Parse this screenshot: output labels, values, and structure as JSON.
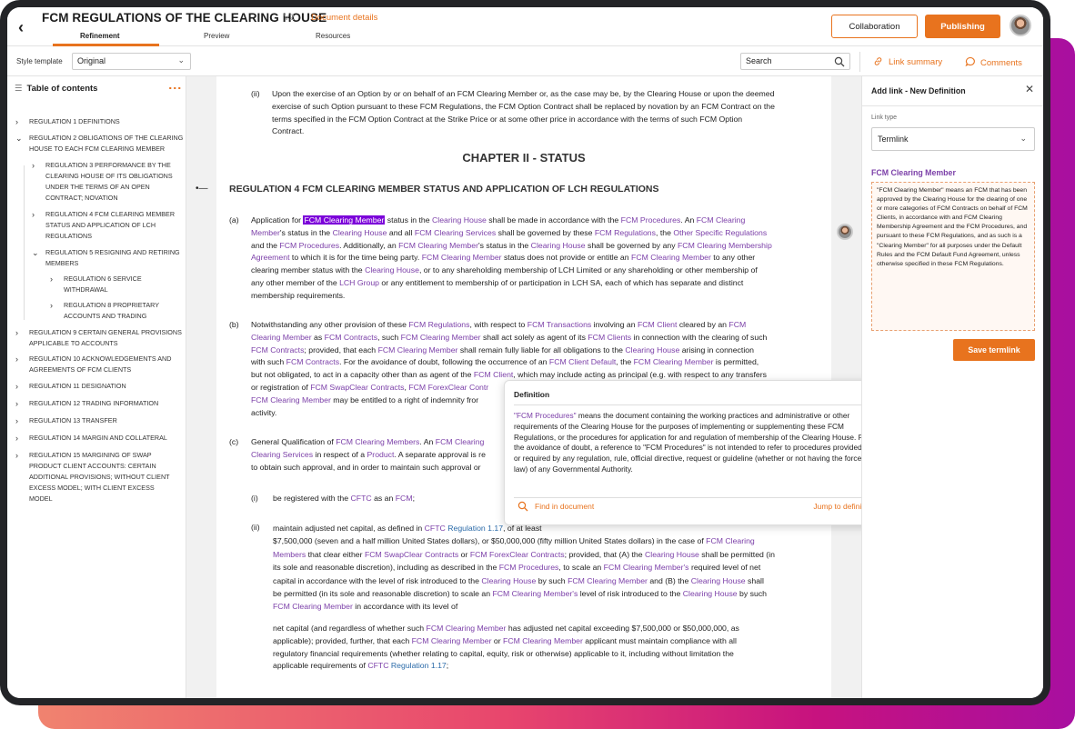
{
  "header": {
    "back": "‹",
    "title": "FCM REGULATIONS OF THE CLEARING HOUSE",
    "version": "V2",
    "details": "Document details",
    "tabs": [
      "Refinement",
      "Preview",
      "Resources"
    ],
    "collaboration": "Collaboration",
    "publishing": "Publishing"
  },
  "toolbar": {
    "style_label": "Style template",
    "style_value": "Original",
    "search_value": "Search",
    "link_summary": "Link summary",
    "comments": "Comments"
  },
  "toc": {
    "title": "Table of contents",
    "items": [
      "Regulation 1 DEFINITIONS",
      [
        "Regulation 2 OBLIGATIONS OF THE CLEARING",
        "HOUSE TO EACH FCM CLEARING MEMBER"
      ],
      [
        "Regulation 3 PERFORMANCE BY THE",
        "CLEARING HOUSE OF ITS OBLIGATIONS",
        "UNDER THE TERMS OF AN OPEN",
        "CONTRACT; NOVATION"
      ],
      [
        "Regulation 4 FCM CLEARING MEMBER",
        "STATUS AND APPLICATION OF LCH",
        "REGULATIONS"
      ],
      [
        "Regulation 5 RESIGNING AND RETIRING",
        "MEMBERS"
      ],
      [
        "Regulation 6 SERVICE",
        "WITHDRAWAL"
      ],
      [
        "Regulation 8 PROPRIETARY",
        "ACCOUNTS AND TRADING"
      ],
      [
        "Regulation 9 CERTAIN GENERAL PROVISIONS",
        "APPLICABLE TO ACCOUNTS"
      ],
      [
        "Regulation 10 ACKNOWLEDGEMENTS AND",
        "AGREEMENTS OF FCM CLIENTS"
      ],
      "Regulation 11 DESIGNATION",
      "Regulation 12 TRADING INFORMATION",
      "Regulation 13 TRANSFER",
      "Regulation 14 MARGIN AND COLLATERAL",
      [
        "Regulation 15 MARGINING OF SWAP",
        "PRODUCT CLIENT ACCOUNTS: CERTAIN",
        "ADDITIONAL PROVISIONS; WITHOUT CLIENT",
        "EXCESS MODEL; WITH CLIENT EXCESS",
        "MODEL"
      ]
    ]
  },
  "doc": {
    "ii_label": "(ii)",
    "ii_lines": [
      "Upon the exercise of an Option by or on behalf of an FCM Clearing Member or, as the case may be, by the Clearing House or upon the deemed",
      "exercise of such Option pursuant to these FCM Regulations, the FCM Option Contract shall be replaced by novation by an FCM Contract on the",
      "terms specified in the FCM Option Contract at the Strike Price or at some other price in accordance with the terms of such FCM Option",
      "Contract."
    ],
    "chapter": "CHAPTER II - STATUS",
    "reg_title": "REGULATION 4 FCM CLEARING MEMBER STATUS AND APPLICATION OF LCH REGULATIONS",
    "a_label": "(a)",
    "b_label": "(b)",
    "c_label": "(c)",
    "ci_label": "(i)",
    "cii_label": "(ii)",
    "ci_text": [
      "be registered with the ",
      "CFTC",
      " as an ",
      "FCM",
      ";"
    ],
    "tail_lines": [
      "net capital (and regardless of whether such FCM Clearing Member has adjusted net capital exceeding $7,500,000 or $50,000,000, as",
      "applicable); provided, further, that each FCM Clearing Member or FCM Clearing Member applicant must maintain compliance with all",
      "regulatory financial requirements (whether relating to capital, equity, risk or otherwise) applicable to it, including without limitation the",
      "applicable requirements of CFTC Regulation 1.17;"
    ]
  },
  "popup": {
    "title": "Definition",
    "term": "\"FCM Procedures\"",
    "body": " means the document containing the working practices and administrative or other requirements of the Clearing House for the purposes of implementing or supplementing these FCM Regulations, or the procedures for application for and regulation of membership of the Clearing House. For the avoidance of doubt, a reference to \"FCM Procedures\" is not intended to refer to procedures provided for or required by any regulation, rule, official directive, request or guideline (whether or not having the force of law) of any Governmental Authority.",
    "find": "Find in document",
    "jump": "Jump to definition"
  },
  "right_panel": {
    "title": "Add link - New Definition",
    "link_type_label": "Link type",
    "link_type_value": "Termlink",
    "term": "FCM Clearing Member",
    "definition": "\"FCM Clearing Member\" means an FCM that has been approved by the Clearing House for the clearing of one or more categories of FCM Contracts on behalf of FCM Clients, in accordance with and FCM Clearing Membership Agreement and the FCM Procedures, and pursuant to these FCM Regulations, and as such is a \"Clearing Member\" for all purposes under the Default Rules and the FCM Default Fund Agreement, unless otherwise specified in these FCM Regulations.",
    "save": "Save termlink"
  },
  "colors": {
    "accent": "#e8731e",
    "term": "#7b3fa8",
    "highlight": "#7b00d9"
  }
}
